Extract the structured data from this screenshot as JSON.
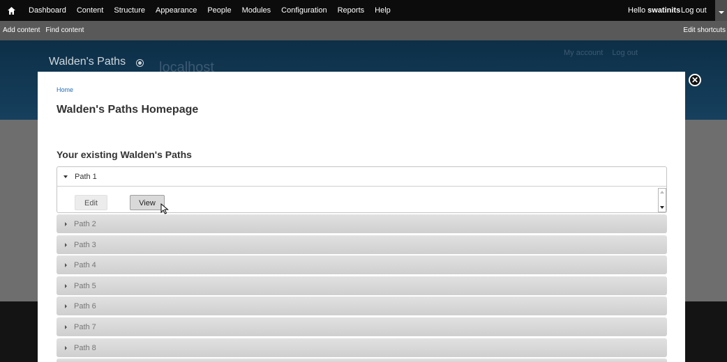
{
  "toolbar": {
    "menu": [
      "Dashboard",
      "Content",
      "Structure",
      "Appearance",
      "People",
      "Modules",
      "Configuration",
      "Reports",
      "Help"
    ],
    "hello": "Hello",
    "username": "swatinits",
    "logout": "Log out"
  },
  "shortcuts": {
    "add_content": "Add content",
    "find_content": "Find content",
    "edit_shortcuts": "Edit shortcuts"
  },
  "site": {
    "name": "Walden's Paths",
    "slogan": "localhost",
    "my_account": "My account",
    "logout": "Log out"
  },
  "overlay": {
    "close": "✕",
    "breadcrumb": "Home",
    "title": "Walden's Paths Homepage",
    "section_title": "Your existing Walden's Paths",
    "open_path": {
      "label": "Path 1",
      "edit_label": "Edit",
      "view_label": "View"
    },
    "paths": [
      "Path 2",
      "Path 3",
      "Path 4",
      "Path 5",
      "Path 6",
      "Path 7",
      "Path 8"
    ]
  }
}
